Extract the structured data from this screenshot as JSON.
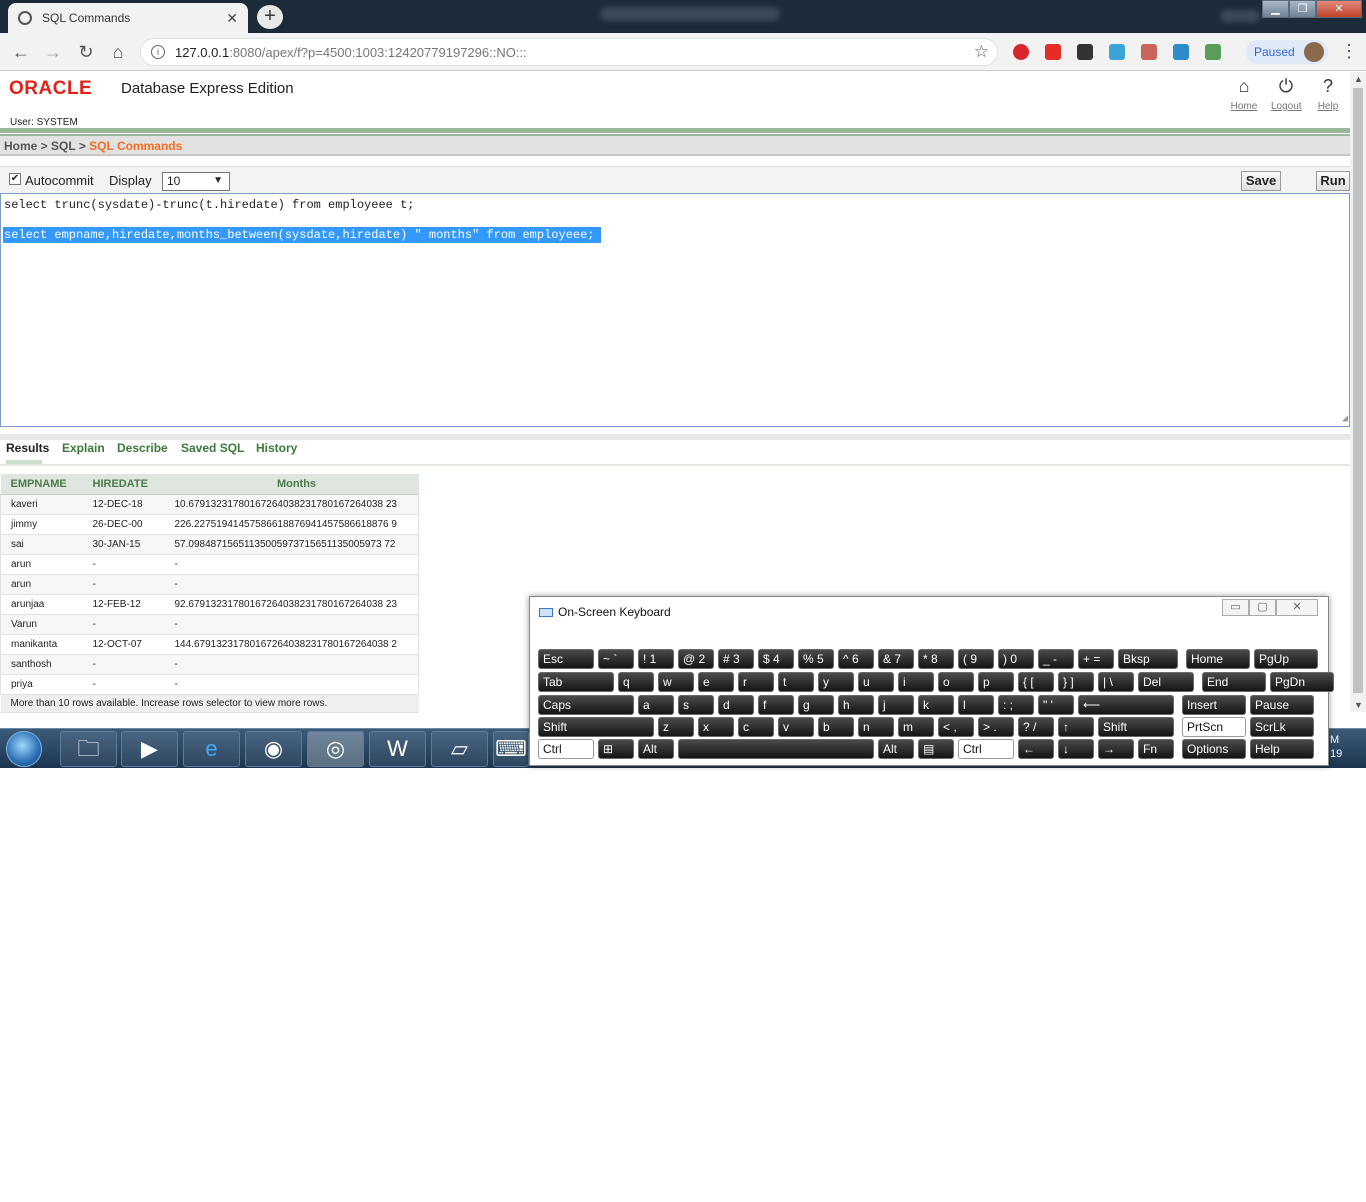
{
  "browser": {
    "tab_title": "SQL Commands",
    "new_tab": "+",
    "url_host": "127.0.0.1",
    "url_rest": ":8080/apex/f?p=4500:1003:12420779197296::NO:::",
    "profile_status": "Paused"
  },
  "app": {
    "logo": "ORACLE",
    "product": "Database Express Edition",
    "user": "User: SYSTEM",
    "top_links": {
      "home": "Home",
      "logout": "Logout",
      "help": "Help"
    },
    "breadcrumb": {
      "home": "Home",
      "sql": "SQL",
      "current": "SQL Commands"
    },
    "autocommit_label": "Autocommit",
    "display_label": "Display",
    "display_value": "10",
    "save_label": "Save",
    "run_label": "Run",
    "sql_line1": "select trunc(sysdate)-trunc(t.hiredate) from employeee t;",
    "sql_line2": "select empname,hiredate,months_between(sysdate,hiredate) \" months\" from employeee;",
    "result_tabs": [
      "Results",
      "Explain",
      "Describe",
      "Saved SQL",
      "History"
    ],
    "columns": [
      "EMPNAME",
      "HIREDATE",
      "Months"
    ],
    "rows": [
      [
        "kaveri",
        "12-DEC-18",
        "10.67913231780167264038231780167264038 23"
      ],
      [
        "jimmy",
        "26-DEC-00",
        "226.22751941457586618876941457586618876 9"
      ],
      [
        "sai",
        "30-JAN-15",
        "57.09848715651135005973715651135005973 72"
      ],
      [
        "arun",
        "-",
        "-"
      ],
      [
        "arun",
        "-",
        "-"
      ],
      [
        "arunjaa",
        "12-FEB-12",
        "92.67913231780167264038231780167264038 23"
      ],
      [
        "Varun",
        "-",
        "-"
      ],
      [
        "manikanta",
        "12-OCT-07",
        "144.67913231780167264038231780167264038 2"
      ],
      [
        "santhosh",
        "-",
        "-"
      ],
      [
        "priya",
        "-",
        "-"
      ]
    ],
    "footer_note": "More than 10 rows available. Increase rows selector to view more rows."
  },
  "taskbar": {
    "clock_line1": "M",
    "clock_line2": "19"
  },
  "osk": {
    "title": "On-Screen Keyboard",
    "rows": [
      [
        "Esc",
        "~ `",
        "! 1",
        "@ 2",
        "# 3",
        "$ 4",
        "% 5",
        "^ 6",
        "& 7",
        "* 8",
        "( 9",
        ") 0",
        "_ -",
        "+ =",
        "Bksp",
        "Home",
        "PgUp"
      ],
      [
        "Tab",
        "q",
        "w",
        "e",
        "r",
        "t",
        "y",
        "u",
        "i",
        "o",
        "p",
        "{ [",
        "} ]",
        "| \\",
        "Del",
        "End",
        "PgDn"
      ],
      [
        "Caps",
        "a",
        "s",
        "d",
        "f",
        "g",
        "h",
        "j",
        "k",
        "l",
        ": ;",
        "\" '",
        "⟵",
        "Insert",
        "Pause"
      ],
      [
        "Shift",
        "z",
        "x",
        "c",
        "v",
        "b",
        "n",
        "m",
        "< ,",
        "> .",
        "? /",
        "↑",
        "Shift",
        "PrtScn",
        "ScrLk"
      ],
      [
        "Ctrl",
        "⊞",
        "Alt",
        "",
        "Alt",
        "▤",
        "Ctrl",
        "←",
        "↓",
        "→",
        "Fn",
        "Options",
        "Help"
      ]
    ]
  }
}
